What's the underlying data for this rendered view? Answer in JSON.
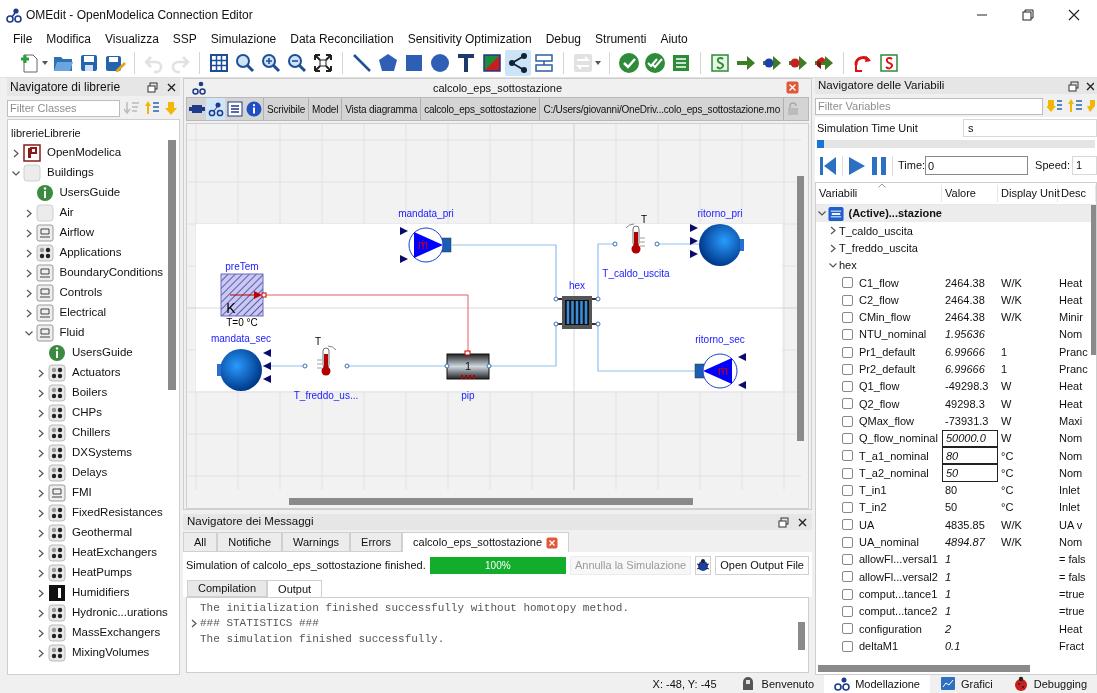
{
  "window": {
    "title": "OMEdit - OpenModelica Connection Editor"
  },
  "menu": [
    "File",
    "Modifica",
    "Visualizza",
    "SSP",
    "Simulazione",
    "Data Reconciliation",
    "Sensitivity Optimization",
    "Debug",
    "Strumenti",
    "Aiuto"
  ],
  "toolbar": [
    {
      "disabled": false,
      "selected": false
    },
    {
      "disabled": false,
      "selected": false
    },
    {
      "disabled": false,
      "selected": false
    },
    {
      "disabled": false,
      "selected": false
    },
    {
      "disabled": true,
      "selected": false
    },
    {
      "disabled": true,
      "selected": false
    },
    {
      "disabled": false,
      "selected": false
    },
    {
      "disabled": false,
      "selected": false
    },
    {
      "disabled": false,
      "selected": false
    },
    {
      "disabled": false,
      "selected": false
    },
    {
      "disabled": false,
      "selected": false
    },
    {
      "disabled": false,
      "selected": false
    },
    {
      "disabled": false,
      "selected": false
    },
    {
      "disabled": false,
      "selected": false
    },
    {
      "disabled": false,
      "selected": false
    },
    {
      "disabled": false,
      "selected": false
    },
    {
      "disabled": false,
      "selected": false
    },
    {
      "disabled": false,
      "selected": true
    },
    {
      "disabled": false,
      "selected": false
    },
    {
      "disabled": true,
      "selected": false
    },
    {
      "disabled": false,
      "selected": false
    },
    {
      "disabled": false,
      "selected": false
    },
    {
      "disabled": false,
      "selected": false
    },
    {
      "disabled": false,
      "selected": false
    },
    {
      "disabled": false,
      "selected": false
    },
    {
      "disabled": false,
      "selected": false
    },
    {
      "disabled": false,
      "selected": false
    },
    {
      "disabled": false,
      "selected": false
    },
    {
      "disabled": false,
      "selected": false
    },
    {
      "disabled": false,
      "selected": false
    }
  ],
  "library_browser": {
    "title": "Navigatore di librerie",
    "filter": {
      "placeholder": "Filter Classes"
    },
    "root_label": "librerieLibrerie",
    "items": [
      {
        "label": "OpenModelica",
        "kind": "logo",
        "expanded": false
      },
      {
        "label": "Buildings",
        "kind": "blank",
        "expanded": true,
        "children": [
          {
            "label": "UsersGuide",
            "kind": "info"
          },
          {
            "label": "Air",
            "kind": "blank",
            "expanded": false
          },
          {
            "label": "Airflow",
            "kind": "symbol",
            "expanded": false
          },
          {
            "label": "Applications",
            "kind": "package",
            "expanded": false
          },
          {
            "label": "BoundaryConditions",
            "kind": "symbol",
            "expanded": false
          },
          {
            "label": "Controls",
            "kind": "symbol",
            "expanded": false
          },
          {
            "label": "Electrical",
            "kind": "symbol",
            "expanded": false
          },
          {
            "label": "Fluid",
            "kind": "symbol",
            "expanded": true,
            "children": [
              {
                "label": "UsersGuide",
                "kind": "info"
              },
              {
                "label": "Actuators",
                "kind": "package",
                "expanded": false
              },
              {
                "label": "Boilers",
                "kind": "package",
                "expanded": false
              },
              {
                "label": "CHPs",
                "kind": "package",
                "expanded": false
              },
              {
                "label": "Chillers",
                "kind": "package",
                "expanded": false
              },
              {
                "label": "DXSystems",
                "kind": "package",
                "expanded": false
              },
              {
                "label": "Delays",
                "kind": "package",
                "expanded": false
              },
              {
                "label": "FMI",
                "kind": "symbol",
                "expanded": false
              },
              {
                "label": "FixedResistances",
                "kind": "package",
                "expanded": false
              },
              {
                "label": "Geothermal",
                "kind": "package",
                "expanded": false
              },
              {
                "label": "HeatExchangers",
                "kind": "package",
                "expanded": false
              },
              {
                "label": "HeatPumps",
                "kind": "package",
                "expanded": false
              },
              {
                "label": "Humidifiers",
                "kind": "dark",
                "expanded": false
              },
              {
                "label": "Hydronic...urations",
                "kind": "package",
                "expanded": false
              },
              {
                "label": "MassExchangers",
                "kind": "package",
                "expanded": false
              },
              {
                "label": "MixingVolumes",
                "kind": "package",
                "expanded": false
              }
            ]
          }
        ]
      }
    ]
  },
  "model_window": {
    "title": "calcolo_eps_sottostazione",
    "views": [
      {
        "selected": false
      },
      {
        "selected": true
      },
      {
        "selected": false
      },
      {
        "selected": false
      }
    ],
    "info": [
      "Scrivibile",
      "Model",
      "Vista diagramma",
      "calcolo_eps_sottostazione",
      "C:/Users/giovanni/OneDriv...colo_eps_sottostazione.mo"
    ],
    "diagram": {
      "components": [
        {
          "kind": "pump",
          "name": "mandata_pri",
          "symbol": "ṁ"
        },
        {
          "kind": "thermometer",
          "name": "T_caldo_uscita",
          "symbol": "T"
        },
        {
          "kind": "boundary",
          "name": "ritorno_pri"
        },
        {
          "kind": "temperature_source",
          "name": "preTem",
          "symbol": "K",
          "parameter": "T=0 °C"
        },
        {
          "kind": "heat_exchanger",
          "name": "hex"
        },
        {
          "kind": "boundary",
          "name": "mandata_sec"
        },
        {
          "kind": "thermometer",
          "name": "T_freddo_us...",
          "symbol": "T"
        },
        {
          "kind": "pipe",
          "name": "pip",
          "symbol": "1"
        },
        {
          "kind": "pump",
          "name": "ritorno_sec",
          "symbol": "ṁ"
        }
      ]
    }
  },
  "messages": {
    "title": "Navigatore dei Messaggi",
    "tabs": [
      {
        "label": "All",
        "selected": false,
        "closable": false
      },
      {
        "label": "Notifiche",
        "selected": false,
        "closable": false
      },
      {
        "label": "Warnings",
        "selected": false,
        "closable": false
      },
      {
        "label": "Errors",
        "selected": false,
        "closable": false
      },
      {
        "label": "calcolo_eps_sottostazione",
        "selected": true,
        "closable": true
      }
    ],
    "status": "Simulation of calcolo_eps_sottostazione finished.",
    "progress": {
      "level": 1,
      "label": "100%"
    },
    "buttons": [
      {
        "label": "Annulla la Simulazione",
        "disabled": true
      },
      {
        "label": "Open Output File",
        "disabled": false
      }
    ],
    "output_tabs": [
      {
        "label": "Compilation",
        "selected": false
      },
      {
        "label": "Output",
        "selected": true
      }
    ],
    "output_lines": [
      {
        "kind": "line",
        "text": "The initialization finished successfully without homotopy method."
      },
      {
        "kind": "group",
        "text": "### STATISTICS ###",
        "expanded": false
      },
      {
        "kind": "line",
        "text": "The simulation finished successfully."
      }
    ]
  },
  "variables_browser": {
    "title": "Navigatore delle Variabili",
    "filter": {
      "placeholder": "Filter Variables"
    },
    "time_unit": {
      "label": "Simulation Time Unit",
      "value": "s"
    },
    "slider": {
      "level": 0
    },
    "time": {
      "label": "Time:",
      "value": "0"
    },
    "speed": {
      "label": "Speed:",
      "value": "1"
    },
    "columns": [
      "Variabili",
      "Valore",
      "Display Unit",
      "Desc"
    ],
    "tree": [
      {
        "name": "(Active)...stazione",
        "expanded": true,
        "children": [
          {
            "name": "T_caldo_uscita",
            "expanded": false
          },
          {
            "name": "T_freddo_uscita",
            "expanded": false
          },
          {
            "name": "hex",
            "expanded": true,
            "children": [
              {
                "name": "C1_flow",
                "value": "2464.38",
                "unit": "W/K",
                "description": "Heat",
                "checked": false,
                "parameter": false,
                "editable": false
              },
              {
                "name": "C2_flow",
                "value": "2464.38",
                "unit": "W/K",
                "description": "Heat",
                "checked": false,
                "parameter": false,
                "editable": false
              },
              {
                "name": "CMin_flow",
                "value": "2464.38",
                "unit": "W/K",
                "description": "Minir",
                "checked": false,
                "parameter": false,
                "editable": false
              },
              {
                "name": "NTU_nominal",
                "value": "1.95636",
                "description": "Nom",
                "checked": false,
                "parameter": true,
                "editable": false
              },
              {
                "name": "Pr1_default",
                "value": "6.99666",
                "unit": "1",
                "description": "Pranc",
                "checked": false,
                "parameter": true,
                "editable": false
              },
              {
                "name": "Pr2_default",
                "value": "6.99666",
                "unit": "1",
                "description": "Pranc",
                "checked": false,
                "parameter": true,
                "editable": false
              },
              {
                "name": "Q1_flow",
                "value": "-49298.3",
                "unit": "W",
                "description": "Heat",
                "checked": false,
                "parameter": false,
                "editable": false
              },
              {
                "name": "Q2_flow",
                "value": "49298.3",
                "unit": "W",
                "description": "Heat",
                "checked": false,
                "parameter": false,
                "editable": false
              },
              {
                "name": "QMax_flow",
                "value": "-73931.3",
                "unit": "W",
                "description": "Maxi",
                "checked": false,
                "parameter": false,
                "editable": false
              },
              {
                "name": "Q_flow_nominal",
                "value": "50000.0",
                "unit": "W",
                "description": "Nom",
                "checked": false,
                "parameter": true,
                "editable": true
              },
              {
                "name": "T_a1_nominal",
                "value": "80",
                "unit": "°C",
                "description": "Nom",
                "checked": false,
                "parameter": true,
                "editable": true
              },
              {
                "name": "T_a2_nominal",
                "value": "50",
                "unit": "°C",
                "description": "Nom",
                "checked": false,
                "parameter": true,
                "editable": true
              },
              {
                "name": "T_in1",
                "value": "80",
                "unit": "°C",
                "description": "Inlet",
                "checked": false,
                "parameter": false,
                "editable": false
              },
              {
                "name": "T_in2",
                "value": "50",
                "unit": "°C",
                "description": "Inlet",
                "checked": false,
                "parameter": false,
                "editable": false
              },
              {
                "name": "UA",
                "value": "4835.85",
                "unit": "W/K",
                "description": "UA v",
                "checked": false,
                "parameter": false,
                "editable": false
              },
              {
                "name": "UA_nominal",
                "value": "4894.87",
                "unit": "W/K",
                "description": "Nom",
                "checked": false,
                "parameter": true,
                "editable": false
              },
              {
                "name": "allowFl...versal1",
                "value": "1",
                "description": "= fals",
                "checked": false,
                "parameter": true,
                "editable": false
              },
              {
                "name": "allowFl...versal2",
                "value": "1",
                "description": "= fals",
                "checked": false,
                "parameter": true,
                "editable": false
              },
              {
                "name": "comput...tance1",
                "value": "1",
                "description": "=true",
                "checked": false,
                "parameter": true,
                "editable": false
              },
              {
                "name": "comput...tance2",
                "value": "1",
                "description": "=true",
                "checked": false,
                "parameter": true,
                "editable": false
              },
              {
                "name": "configuration",
                "value": "2",
                "description": "Heat",
                "checked": false,
                "parameter": true,
                "editable": false
              },
              {
                "name": "deltaM1",
                "value": "0.1",
                "description": "Fract",
                "checked": false,
                "parameter": true,
                "editable": false
              }
            ]
          }
        ]
      }
    ]
  },
  "status_bar": {
    "coordinates": "X: -48, Y: -45",
    "perspectives": [
      {
        "label": "Benvenuto",
        "selected": false
      },
      {
        "label": "Modellazione",
        "selected": true
      },
      {
        "label": "Grafici",
        "selected": false
      },
      {
        "label": "Debugging",
        "selected": false
      }
    ]
  }
}
